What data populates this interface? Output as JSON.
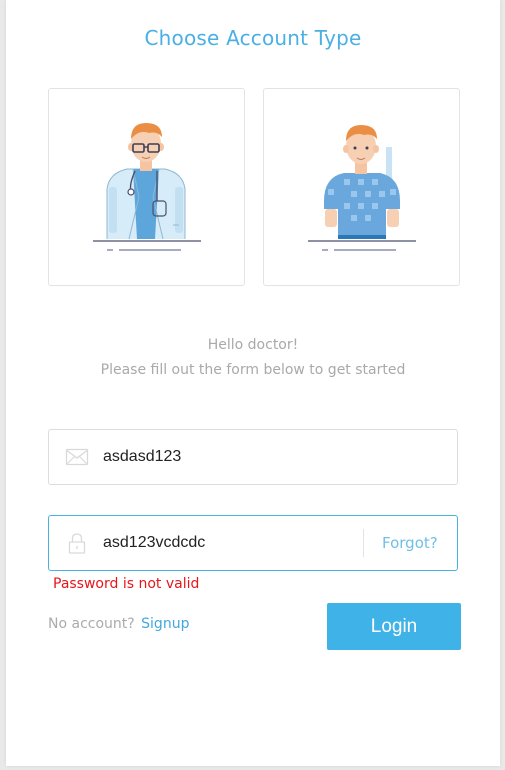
{
  "page": {
    "title": "Choose Account Type"
  },
  "account_types": [
    {
      "id": "doctor",
      "icon": "doctor-illustration",
      "selected": true
    },
    {
      "id": "patient",
      "icon": "patient-illustration",
      "selected": false
    }
  ],
  "greeting": {
    "line1": "Hello doctor!",
    "line2": "Please fill out the form below to get started"
  },
  "form": {
    "email_value": "asdasd123",
    "email_icon": "envelope-icon",
    "password_value": "asd123vcdcdc",
    "password_icon": "lock-icon",
    "forgot_label": "Forgot?",
    "error_text": "Password is not valid",
    "no_account_text": "No account?",
    "signup_label": "Signup",
    "login_label": "Login"
  },
  "colors": {
    "accent": "#3fb3e8",
    "title": "#4ab0e4",
    "error": "#e8151b",
    "muted": "#a9a9a9"
  }
}
